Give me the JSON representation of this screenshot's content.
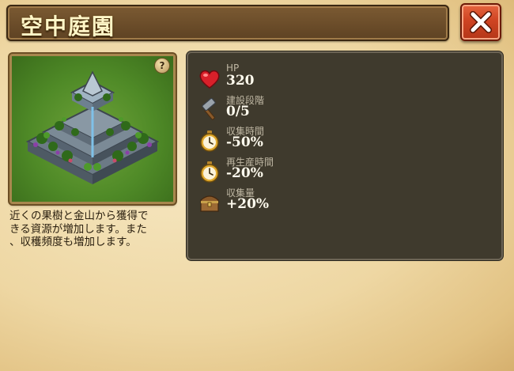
{
  "title": "空中庭園",
  "close_icon": "close-x-icon",
  "help_icon_glyph": "?",
  "description": {
    "lines": [
      "近くの果樹と金山から獲得で",
      "きる資源が増加します。また",
      "、収穫頻度も増加します。"
    ]
  },
  "stats": [
    {
      "icon": "heart-icon",
      "label": "HP",
      "value": "320"
    },
    {
      "icon": "hammer-icon",
      "label": "建設段階",
      "value": "0/5"
    },
    {
      "icon": "stopwatch-icon",
      "label": "収集時間",
      "value": "-50%"
    },
    {
      "icon": "stopwatch-icon",
      "label": "再生産時間",
      "value": "-20%"
    },
    {
      "icon": "chest-icon",
      "label": "収集量",
      "value": "+20%"
    }
  ],
  "colors": {
    "title_text": "#fff6c8",
    "close_button": "#cf4423",
    "panel_bg": "#3f3a2d",
    "grass": "#4f8a27"
  }
}
